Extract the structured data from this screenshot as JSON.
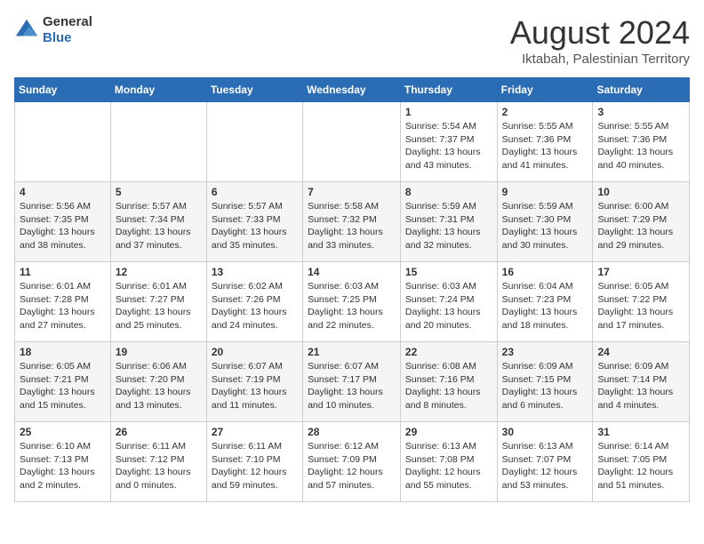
{
  "header": {
    "logo_line1": "General",
    "logo_line2": "Blue",
    "title": "August 2024",
    "subtitle": "Iktabah, Palestinian Territory"
  },
  "days_of_week": [
    "Sunday",
    "Monday",
    "Tuesday",
    "Wednesday",
    "Thursday",
    "Friday",
    "Saturday"
  ],
  "weeks": [
    [
      {
        "day": "",
        "info": ""
      },
      {
        "day": "",
        "info": ""
      },
      {
        "day": "",
        "info": ""
      },
      {
        "day": "",
        "info": ""
      },
      {
        "day": "1",
        "info": "Sunrise: 5:54 AM\nSunset: 7:37 PM\nDaylight: 13 hours\nand 43 minutes."
      },
      {
        "day": "2",
        "info": "Sunrise: 5:55 AM\nSunset: 7:36 PM\nDaylight: 13 hours\nand 41 minutes."
      },
      {
        "day": "3",
        "info": "Sunrise: 5:55 AM\nSunset: 7:36 PM\nDaylight: 13 hours\nand 40 minutes."
      }
    ],
    [
      {
        "day": "4",
        "info": "Sunrise: 5:56 AM\nSunset: 7:35 PM\nDaylight: 13 hours\nand 38 minutes."
      },
      {
        "day": "5",
        "info": "Sunrise: 5:57 AM\nSunset: 7:34 PM\nDaylight: 13 hours\nand 37 minutes."
      },
      {
        "day": "6",
        "info": "Sunrise: 5:57 AM\nSunset: 7:33 PM\nDaylight: 13 hours\nand 35 minutes."
      },
      {
        "day": "7",
        "info": "Sunrise: 5:58 AM\nSunset: 7:32 PM\nDaylight: 13 hours\nand 33 minutes."
      },
      {
        "day": "8",
        "info": "Sunrise: 5:59 AM\nSunset: 7:31 PM\nDaylight: 13 hours\nand 32 minutes."
      },
      {
        "day": "9",
        "info": "Sunrise: 5:59 AM\nSunset: 7:30 PM\nDaylight: 13 hours\nand 30 minutes."
      },
      {
        "day": "10",
        "info": "Sunrise: 6:00 AM\nSunset: 7:29 PM\nDaylight: 13 hours\nand 29 minutes."
      }
    ],
    [
      {
        "day": "11",
        "info": "Sunrise: 6:01 AM\nSunset: 7:28 PM\nDaylight: 13 hours\nand 27 minutes."
      },
      {
        "day": "12",
        "info": "Sunrise: 6:01 AM\nSunset: 7:27 PM\nDaylight: 13 hours\nand 25 minutes."
      },
      {
        "day": "13",
        "info": "Sunrise: 6:02 AM\nSunset: 7:26 PM\nDaylight: 13 hours\nand 24 minutes."
      },
      {
        "day": "14",
        "info": "Sunrise: 6:03 AM\nSunset: 7:25 PM\nDaylight: 13 hours\nand 22 minutes."
      },
      {
        "day": "15",
        "info": "Sunrise: 6:03 AM\nSunset: 7:24 PM\nDaylight: 13 hours\nand 20 minutes."
      },
      {
        "day": "16",
        "info": "Sunrise: 6:04 AM\nSunset: 7:23 PM\nDaylight: 13 hours\nand 18 minutes."
      },
      {
        "day": "17",
        "info": "Sunrise: 6:05 AM\nSunset: 7:22 PM\nDaylight: 13 hours\nand 17 minutes."
      }
    ],
    [
      {
        "day": "18",
        "info": "Sunrise: 6:05 AM\nSunset: 7:21 PM\nDaylight: 13 hours\nand 15 minutes."
      },
      {
        "day": "19",
        "info": "Sunrise: 6:06 AM\nSunset: 7:20 PM\nDaylight: 13 hours\nand 13 minutes."
      },
      {
        "day": "20",
        "info": "Sunrise: 6:07 AM\nSunset: 7:19 PM\nDaylight: 13 hours\nand 11 minutes."
      },
      {
        "day": "21",
        "info": "Sunrise: 6:07 AM\nSunset: 7:17 PM\nDaylight: 13 hours\nand 10 minutes."
      },
      {
        "day": "22",
        "info": "Sunrise: 6:08 AM\nSunset: 7:16 PM\nDaylight: 13 hours\nand 8 minutes."
      },
      {
        "day": "23",
        "info": "Sunrise: 6:09 AM\nSunset: 7:15 PM\nDaylight: 13 hours\nand 6 minutes."
      },
      {
        "day": "24",
        "info": "Sunrise: 6:09 AM\nSunset: 7:14 PM\nDaylight: 13 hours\nand 4 minutes."
      }
    ],
    [
      {
        "day": "25",
        "info": "Sunrise: 6:10 AM\nSunset: 7:13 PM\nDaylight: 13 hours\nand 2 minutes."
      },
      {
        "day": "26",
        "info": "Sunrise: 6:11 AM\nSunset: 7:12 PM\nDaylight: 13 hours\nand 0 minutes."
      },
      {
        "day": "27",
        "info": "Sunrise: 6:11 AM\nSunset: 7:10 PM\nDaylight: 12 hours\nand 59 minutes."
      },
      {
        "day": "28",
        "info": "Sunrise: 6:12 AM\nSunset: 7:09 PM\nDaylight: 12 hours\nand 57 minutes."
      },
      {
        "day": "29",
        "info": "Sunrise: 6:13 AM\nSunset: 7:08 PM\nDaylight: 12 hours\nand 55 minutes."
      },
      {
        "day": "30",
        "info": "Sunrise: 6:13 AM\nSunset: 7:07 PM\nDaylight: 12 hours\nand 53 minutes."
      },
      {
        "day": "31",
        "info": "Sunrise: 6:14 AM\nSunset: 7:05 PM\nDaylight: 12 hours\nand 51 minutes."
      }
    ]
  ]
}
